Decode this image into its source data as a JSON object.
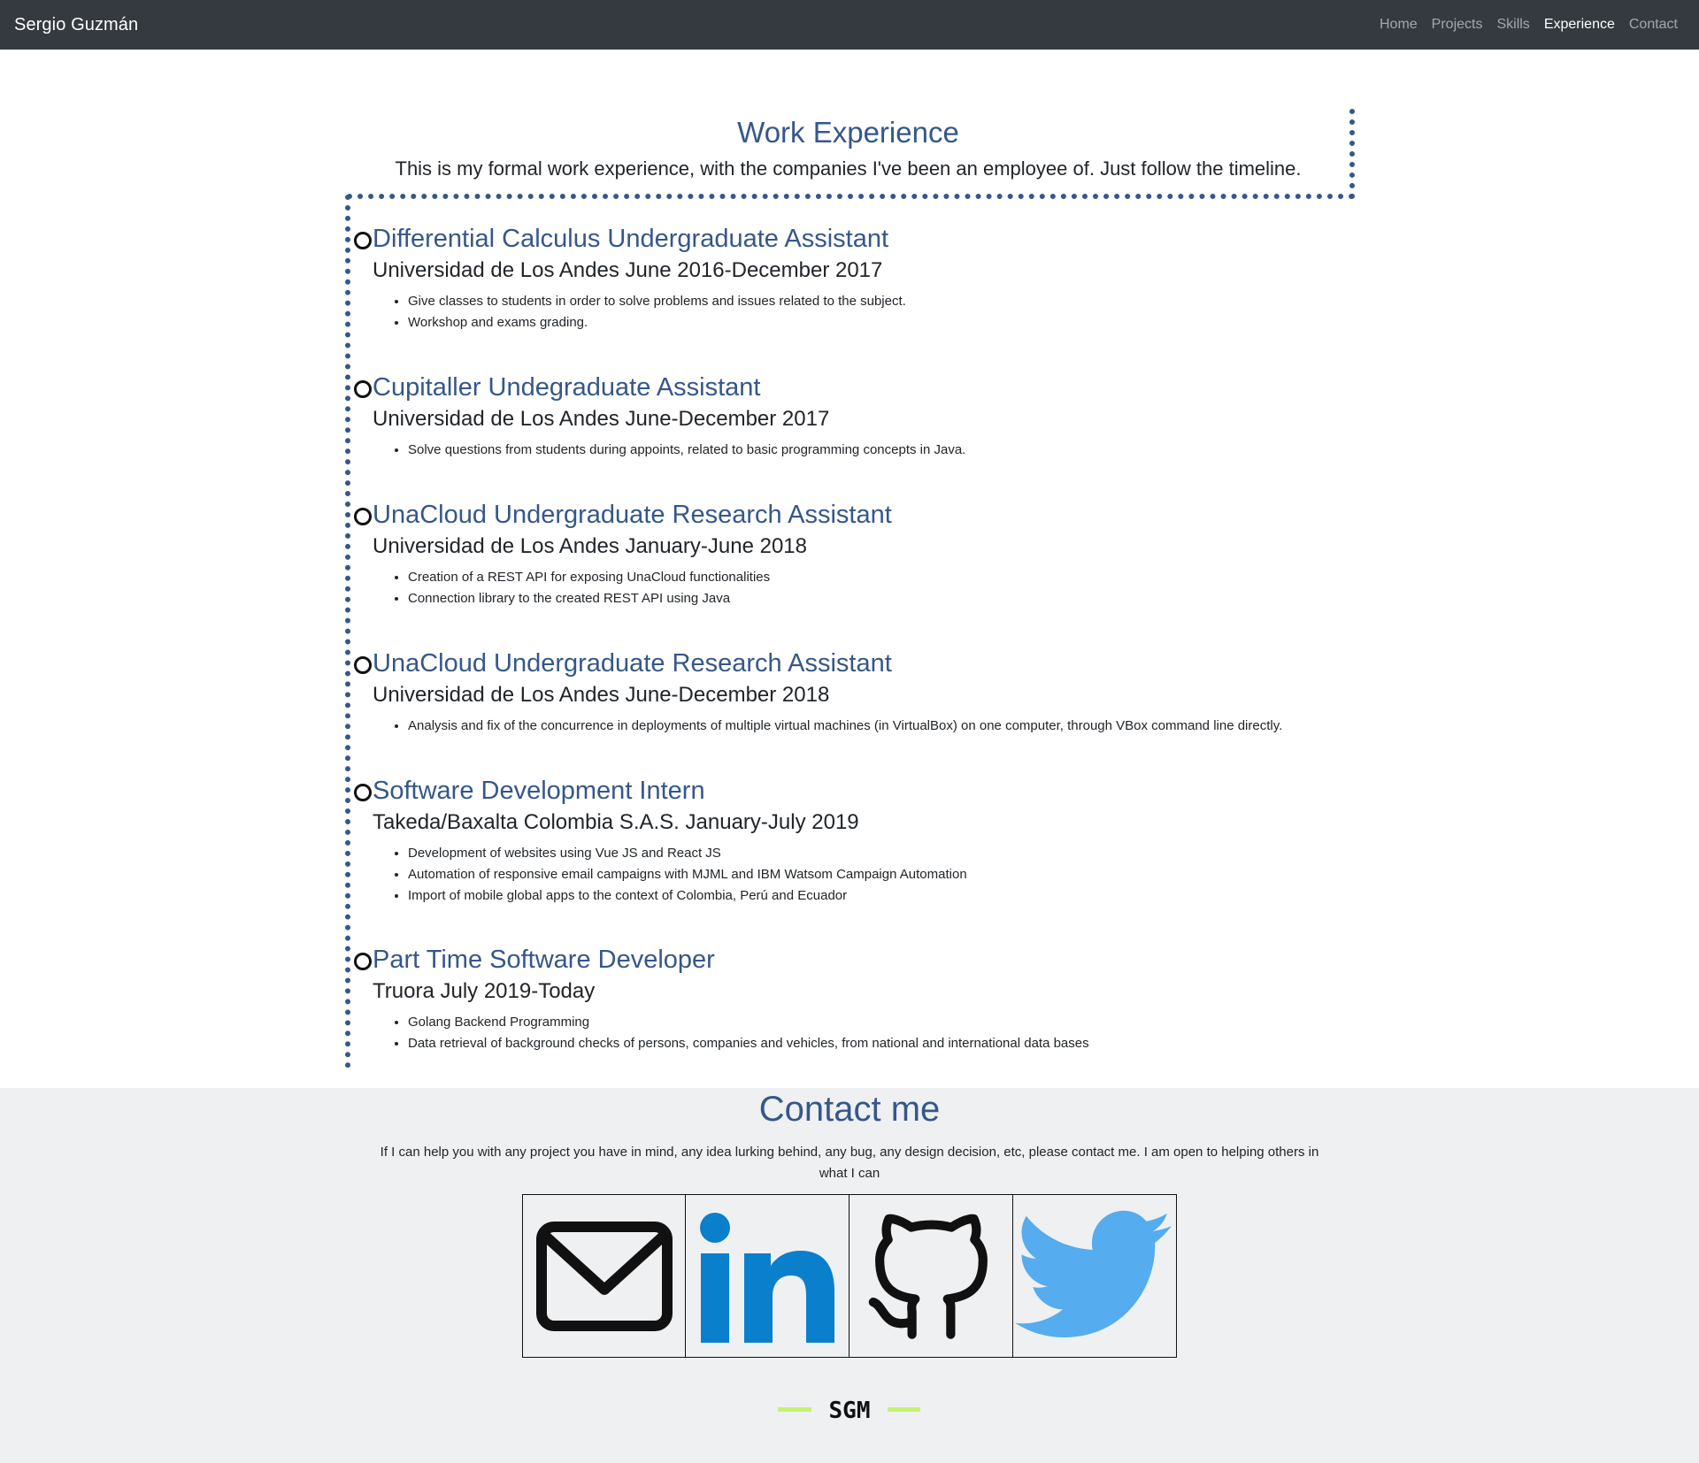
{
  "navbar": {
    "brand": "Sergio Guzmán",
    "links": [
      "Home",
      "Projects",
      "Skills",
      "Experience",
      "Contact"
    ],
    "active": "Experience"
  },
  "experience": {
    "title": "Work Experience",
    "subtitle": "This is my formal work experience, with the companies I've been an employee of. Just follow the timeline.",
    "jobs": [
      {
        "title": "Differential Calculus Undergraduate Assistant",
        "company": "Universidad de Los Andes June 2016-December 2017",
        "tasks": [
          "Give classes to students in order to solve problems and issues related to the subject.",
          "Workshop and exams grading."
        ]
      },
      {
        "title": "Cupitaller Undegraduate Assistant",
        "company": "Universidad de Los Andes June-December 2017",
        "tasks": [
          "Solve questions from students during appoints, related to basic programming concepts in Java."
        ]
      },
      {
        "title": "UnaCloud Undergraduate Research Assistant",
        "company": "Universidad de Los Andes January-June 2018",
        "tasks": [
          "Creation of a REST API for exposing UnaCloud functionalities",
          "Connection library to the created REST API using Java"
        ]
      },
      {
        "title": "UnaCloud Undergraduate Research Assistant",
        "company": "Universidad de Los Andes June-December 2018",
        "tasks": [
          "Analysis and fix of the concurrence in deployments of multiple virtual machines (in VirtualBox) on one computer, through VBox command line directly."
        ]
      },
      {
        "title": "Software Development Intern",
        "company": "Takeda/Baxalta Colombia S.A.S. January-July 2019",
        "tasks": [
          "Development of websites using Vue JS and React JS",
          "Automation of responsive email campaigns with MJML and IBM Watsom Campaign Automation",
          "Import of mobile global apps to the context of Colombia, Perú and Ecuador"
        ]
      },
      {
        "title": "Part Time Software Developer",
        "company": "Truora July 2019-Today",
        "tasks": [
          "Golang Backend Programming",
          "Data retrieval of background checks of persons, companies and vehicles, from national and international data bases"
        ]
      }
    ]
  },
  "contact": {
    "title": "Contact me",
    "text": "If I can help you with any project you have in mind, any idea lurking behind, any bug, any design decision, etc, please contact me. I am open to helping others in what I can",
    "socials": [
      "email-icon",
      "linkedin-icon",
      "github-icon",
      "twitter-icon"
    ]
  },
  "footer": {
    "logo": "SGM"
  },
  "colors": {
    "navbar_bg": "#343a40",
    "accent": "#35578a",
    "contact_bg": "#eff0f2",
    "linkedin": "#0a7fcc",
    "twitter": "#55acee",
    "logo_stripe": "#c6f26e"
  }
}
